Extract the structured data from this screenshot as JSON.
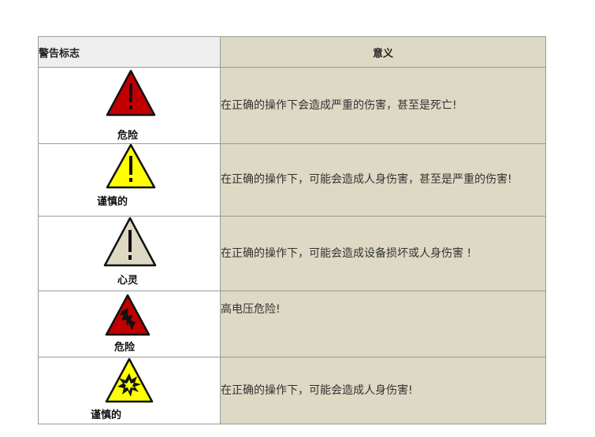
{
  "header": {
    "col1": "警告标志",
    "col2": "意义"
  },
  "rows": [
    {
      "label": "危险",
      "symbol": "exclamation-triangle-red",
      "meaning": "在正确的操作下会造成严重的伤害，甚至是死亡!"
    },
    {
      "label": "谨慎的",
      "symbol": "exclamation-triangle-yellow",
      "meaning": "在正确的操作下，可能会造成人身伤害，甚至是严重的伤害!"
    },
    {
      "label": "心灵",
      "symbol": "exclamation-triangle-gray",
      "meaning": "在正确的操作下，可能会造成设备损坏或人身伤害 !"
    },
    {
      "label": "危险",
      "symbol": "high-voltage-triangle-red",
      "meaning": "高电压危险!"
    },
    {
      "label": "谨慎的",
      "symbol": "explosion-triangle-yellow",
      "meaning": "在正确的操作下，可能会造成人身伤害!"
    }
  ],
  "colors": {
    "red": "#c00000",
    "yellow": "#ffff00",
    "gray": "#ddd9c4",
    "beige": "#ddd9c4"
  }
}
